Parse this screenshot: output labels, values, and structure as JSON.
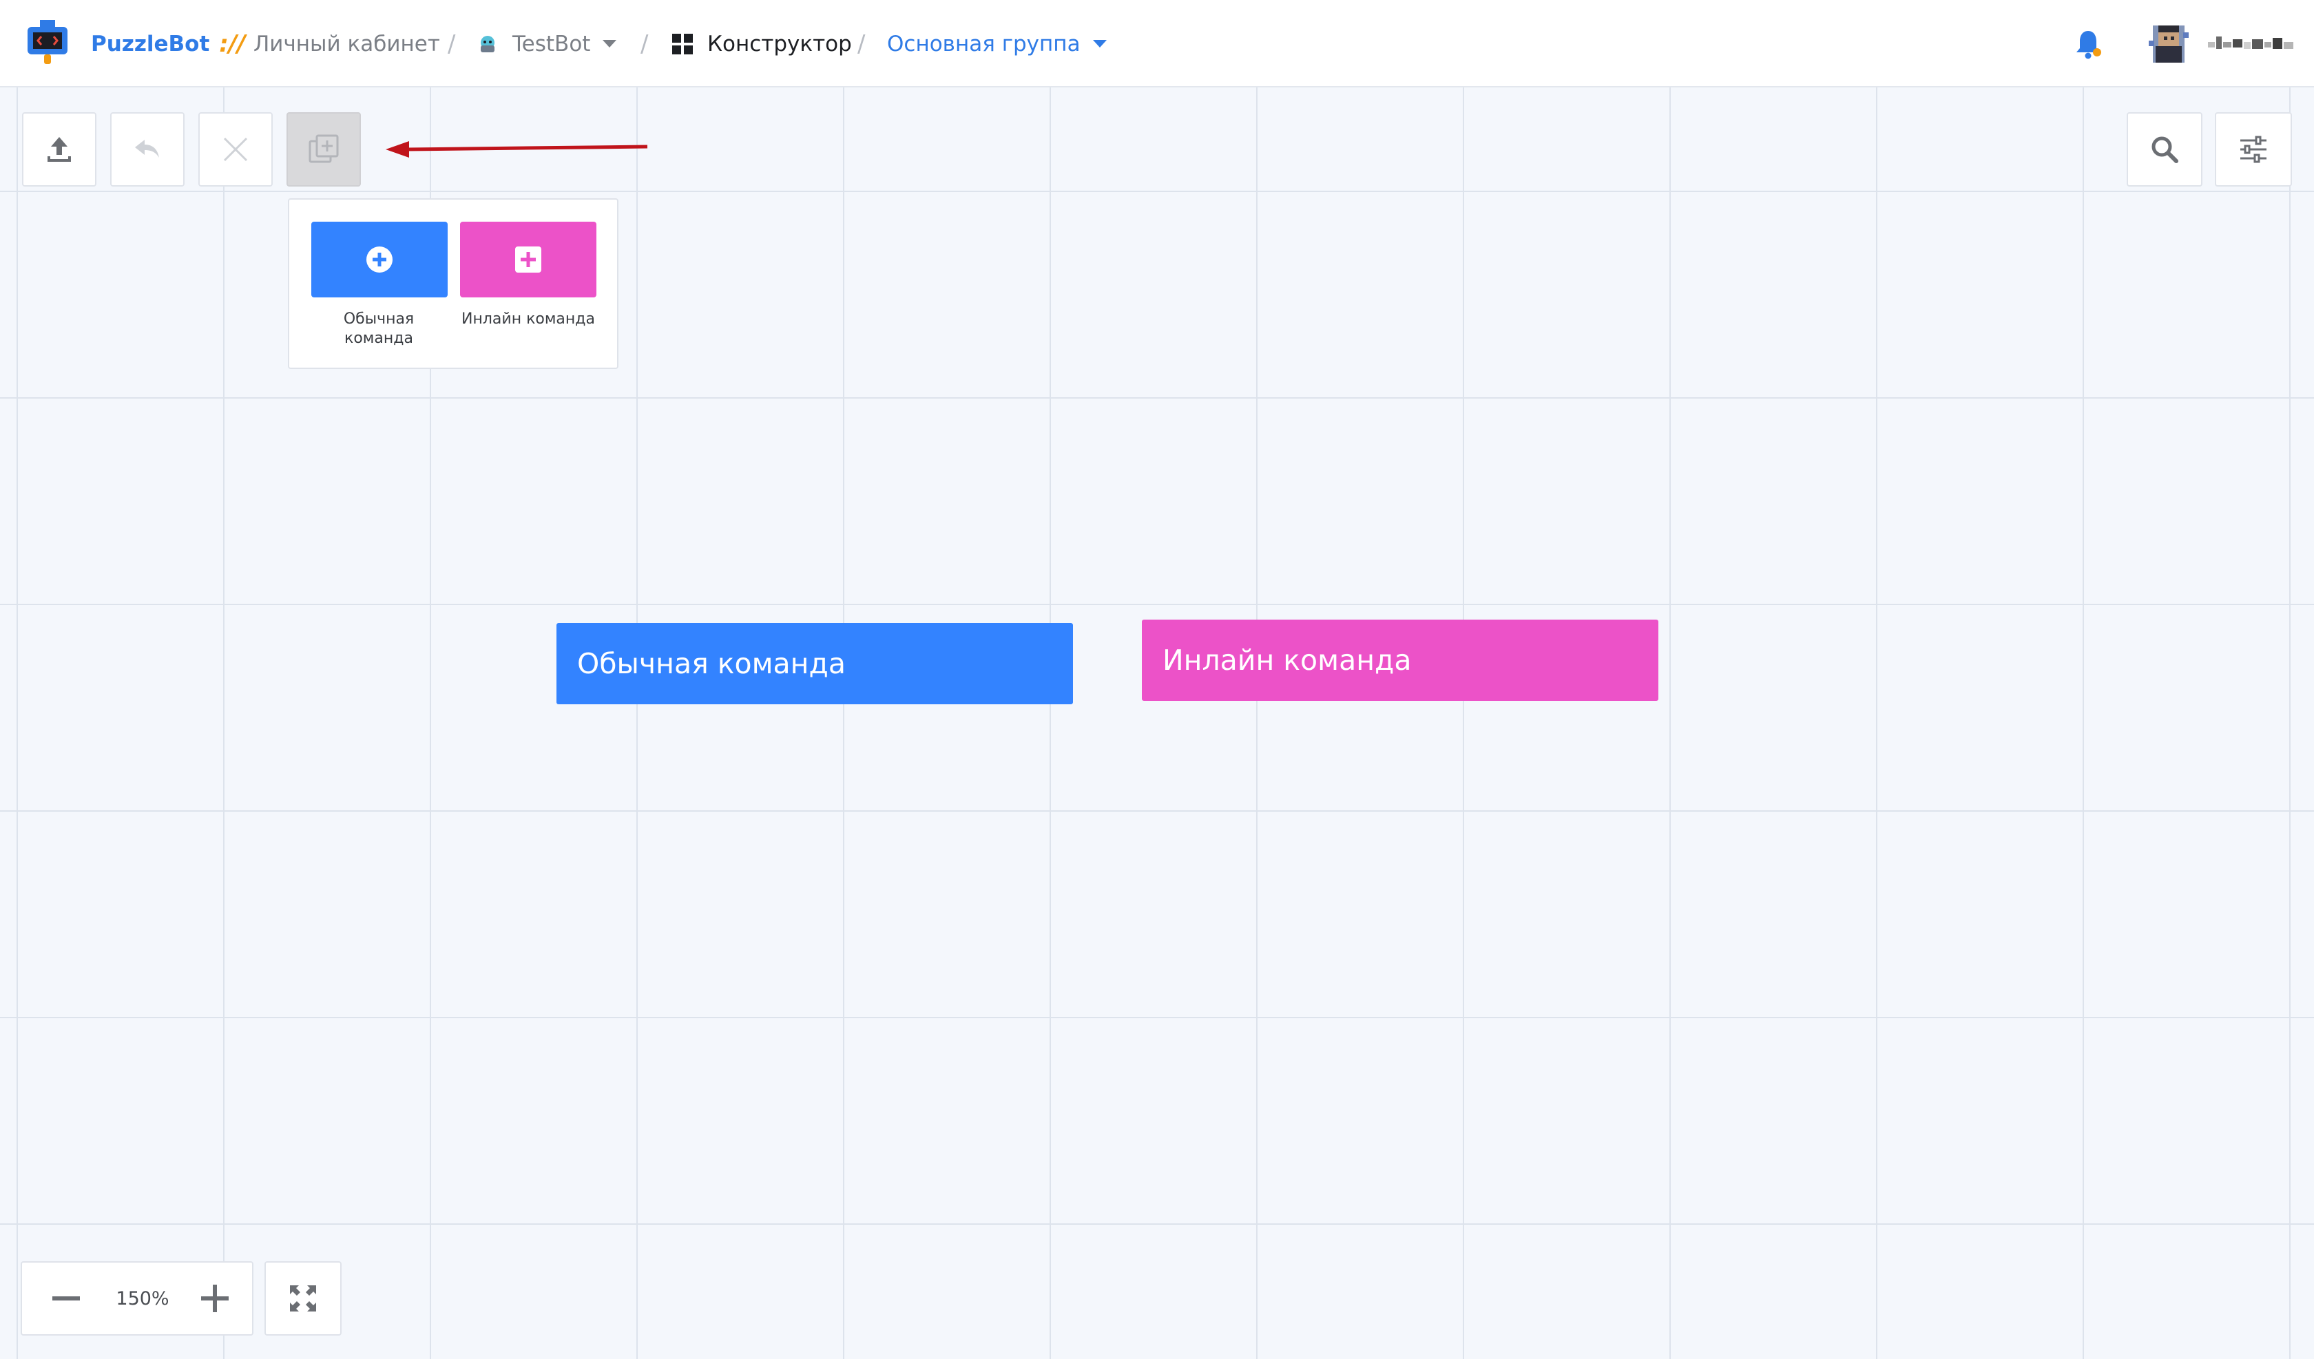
{
  "header": {
    "brand": "PuzzleBot",
    "brand_separator": "://",
    "breadcrumbs": {
      "cabinet": "Личный кабинет",
      "bot": "TestBot",
      "constructor": "Конструктор",
      "group": "Основная группа"
    },
    "separator": "/"
  },
  "toolbar": {
    "icons": [
      "upload-icon",
      "undo-icon",
      "close-icon",
      "add-block-icon"
    ]
  },
  "popup": {
    "regular_label": "Обычная команда",
    "regular_label_line1": "Обычная",
    "regular_label_line2": "команда",
    "inline_label": "Инлайн команда"
  },
  "nodes": {
    "regular": "Обычная команда",
    "inline": "Инлайн команда"
  },
  "zoom": {
    "value": "150%"
  },
  "colors": {
    "accent_blue": "#3383ff",
    "accent_pink": "#ec52c8",
    "brand_blue": "#2f7be6",
    "arrow_red": "#c0141b"
  }
}
